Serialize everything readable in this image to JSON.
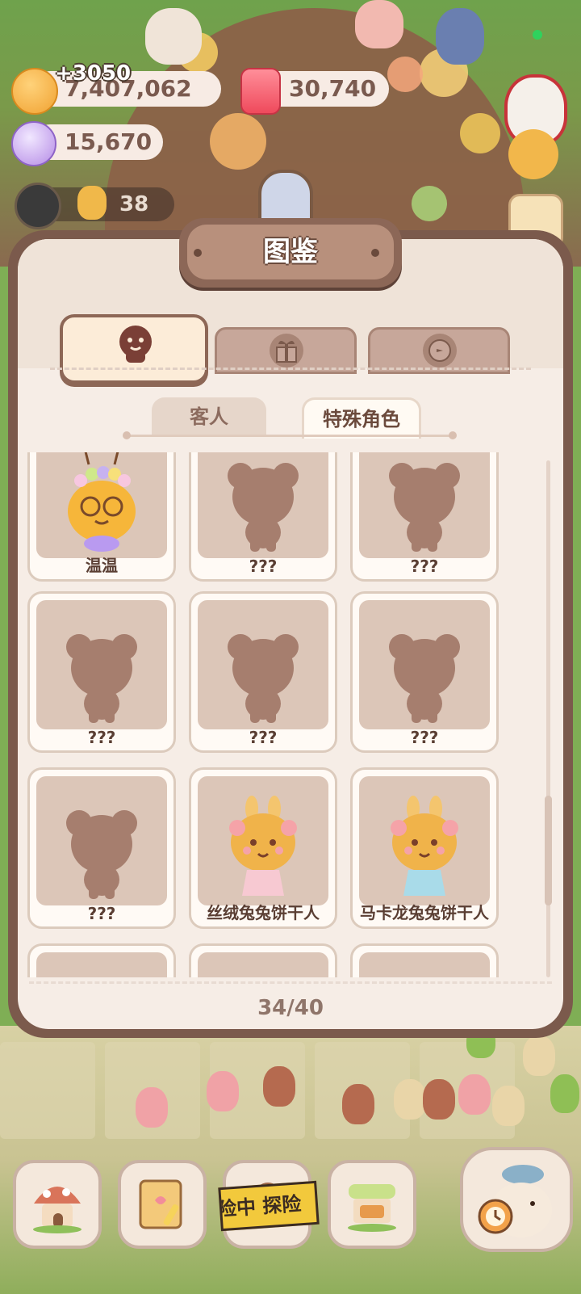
{
  "currency": {
    "cookies": "7,407,062",
    "cookies_gain": "+3050",
    "gems": "30,740",
    "candy": "15,670",
    "tokens": "38"
  },
  "panel": {
    "title": "图鉴",
    "top_tabs": [
      {
        "icon": "cookie-face-icon",
        "active": true
      },
      {
        "icon": "gift-box-icon",
        "active": false
      },
      {
        "icon": "bird-badge-icon",
        "active": false
      }
    ],
    "sub_tabs": [
      {
        "label": "客人",
        "active": false
      },
      {
        "label": "特殊角色",
        "active": true
      }
    ],
    "cards": [
      {
        "name": "温温",
        "unlocked": true,
        "art": "bee-cookie"
      },
      {
        "name": "???",
        "unlocked": false
      },
      {
        "name": "???",
        "unlocked": false
      },
      {
        "name": "???",
        "unlocked": false
      },
      {
        "name": "???",
        "unlocked": false
      },
      {
        "name": "???",
        "unlocked": false
      },
      {
        "name": "???",
        "unlocked": false
      },
      {
        "name": "丝绒兔兔饼干人",
        "unlocked": true,
        "art": "bunny-cookie-pink"
      },
      {
        "name": "马卡龙兔兔饼干人",
        "unlocked": true,
        "art": "bunny-cookie-blue"
      }
    ],
    "counter": "34/40"
  },
  "bottom_nav": {
    "items": [
      "mushroom-house-icon",
      "notebook-icon",
      "explore-icon",
      "shop-stall-icon",
      "fish-clock-icon"
    ],
    "explore_banner": "险中 探险"
  },
  "colors": {
    "panel_frame": "#7b5a4c",
    "panel_bg": "#f6ede6",
    "card_bg": "#dcc6b8",
    "silhouette": "#a67e6e",
    "text_dark": "#5a3e33"
  }
}
